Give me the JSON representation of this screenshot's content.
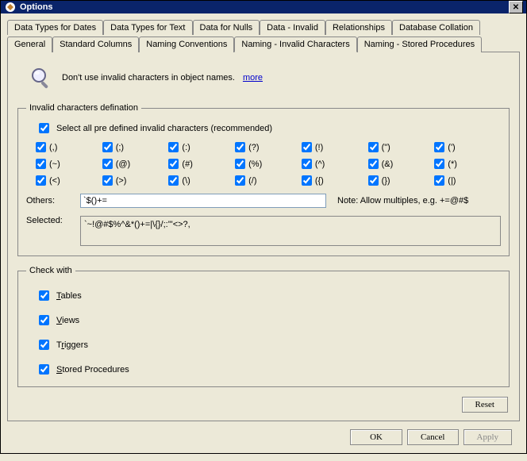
{
  "window": {
    "title": "Options"
  },
  "tabs": {
    "row1": [
      "Data Types for Dates",
      "Data Types for Text",
      "Data for Nulls",
      "Data - Invalid",
      "Relationships",
      "Database Collation"
    ],
    "row2": [
      "General",
      "Standard Columns",
      "Naming Conventions",
      "Naming - Invalid Characters",
      "Naming - Stored Procedures"
    ],
    "active": "Naming - Invalid Characters"
  },
  "hint": {
    "text": "Don't use invalid characters in object names.",
    "more": "more"
  },
  "fs1": {
    "legend": "Invalid characters defination",
    "select_all": "Select all pre defined invalid characters (recommended)",
    "chars": [
      "(,)",
      "(;)",
      "(:)",
      "(?)",
      "(!)",
      "(\")",
      "(')",
      "(~)",
      "(@)",
      "(#)",
      "(%)",
      "(^)",
      "(&)",
      "(*)",
      "(<)",
      "(>)",
      "(\\)",
      "(/)",
      "({)",
      "(})",
      "(|)"
    ],
    "others_label": "Others:",
    "others_value": "`$()+=",
    "note": "Note: Allow multiples, e.g. +=@#$",
    "selected_label": "Selected:",
    "selected_value": "`~!@#$%^&*()+=|\\{}/;:'\"<>?,"
  },
  "fs2": {
    "legend": "Check with",
    "items": [
      "Tables",
      "Views",
      "Triggers",
      "Stored Procedures"
    ],
    "mnemonics": [
      "T",
      "V",
      "r",
      "S"
    ]
  },
  "buttons": {
    "reset": "Reset",
    "ok": "OK",
    "cancel": "Cancel",
    "apply": "Apply"
  }
}
